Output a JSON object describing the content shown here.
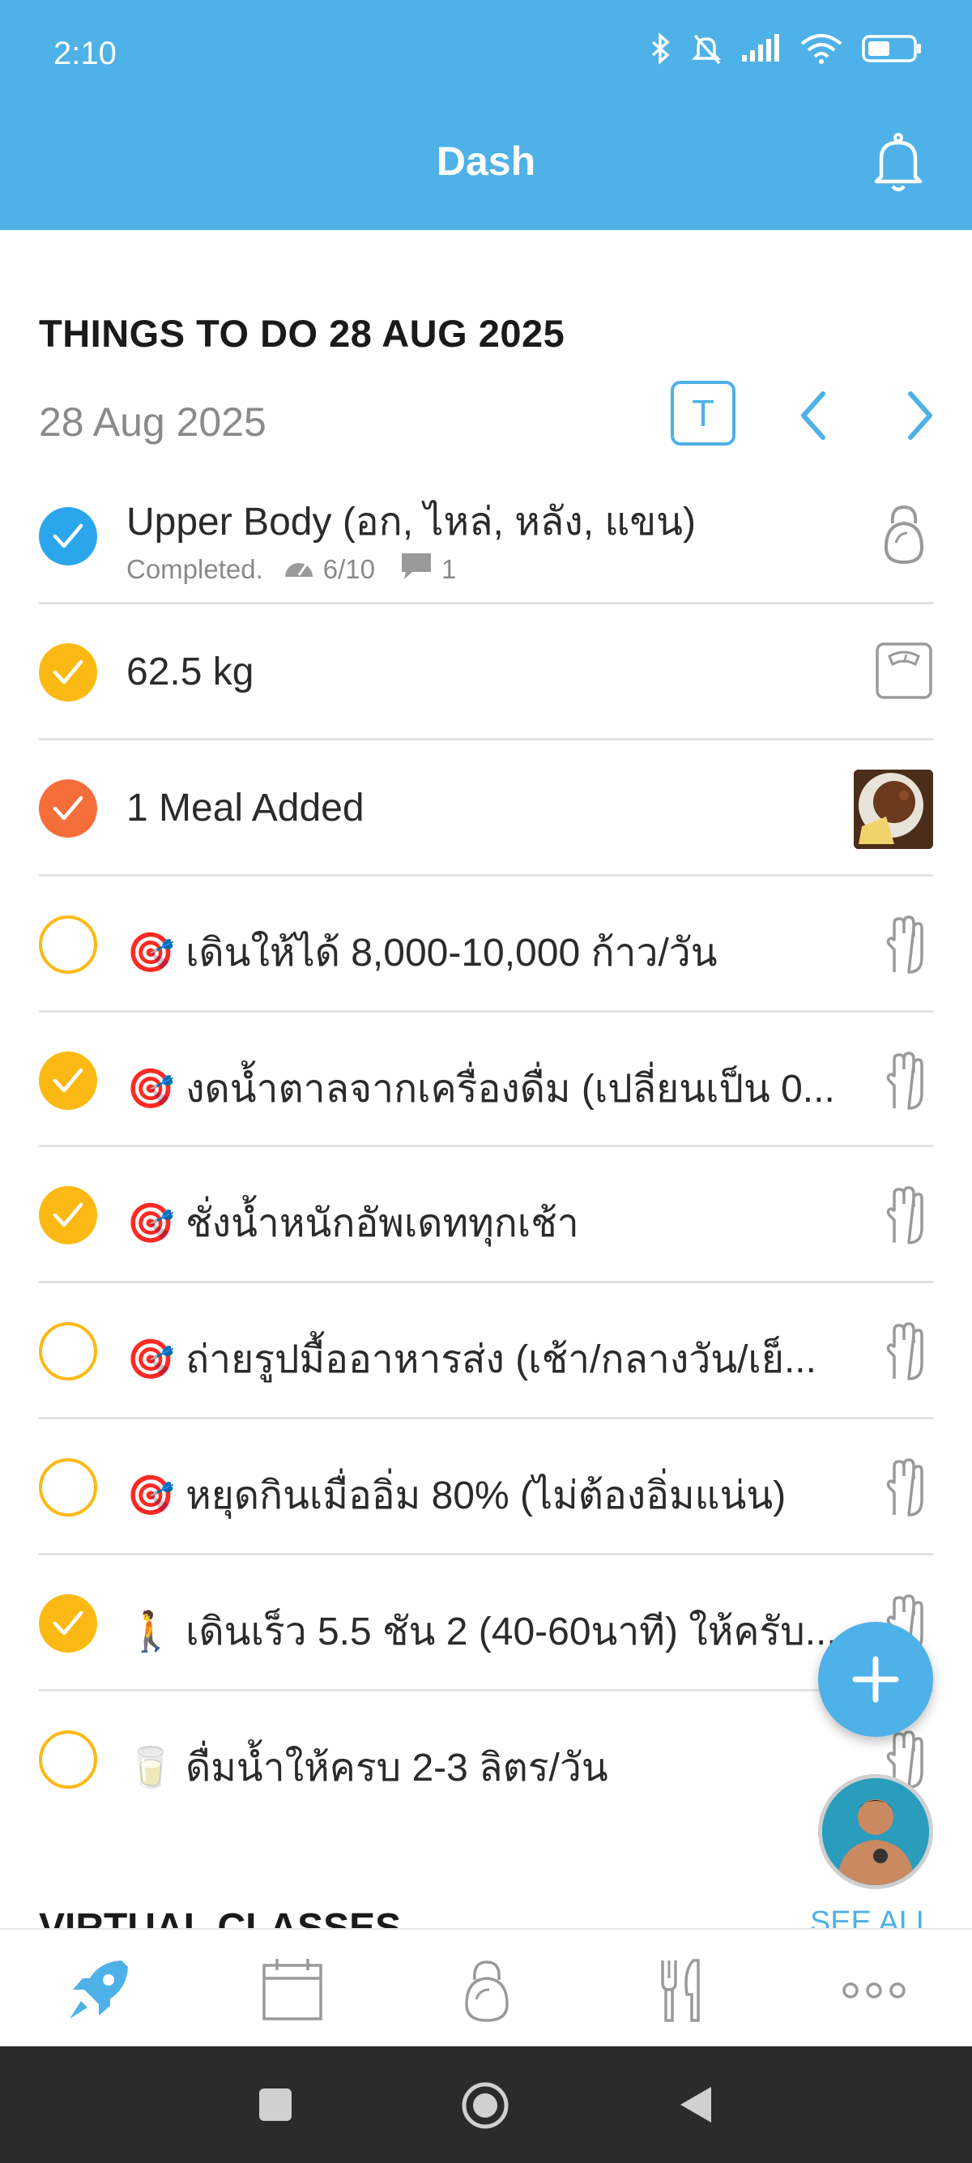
{
  "status": {
    "time": "2:10"
  },
  "header": {
    "title": "Dash"
  },
  "section": {
    "title": "THINGS TO DO 28 AUG 2025",
    "date": "28 Aug 2025",
    "today_button": "T"
  },
  "items": [
    {
      "label": "Upper Body (อก, ไหล่, หลัง, แขน)",
      "status": "Completed.",
      "effort": "6/10",
      "comments": "1",
      "check": "blue",
      "icon": "kettlebell-icon"
    },
    {
      "label": "62.5 kg",
      "check": "yellow",
      "icon": "scale-icon"
    },
    {
      "label": "1 Meal Added",
      "check": "orange",
      "icon": "meal-photo"
    },
    {
      "label": "🎯 เดินให้ได้ 8,000-10,000 ก้าว/วัน",
      "check": "empty",
      "icon": "hand-icon"
    },
    {
      "label": "🎯 งดน้ำตาลจากเครื่องดื่ม (เปลี่ยนเป็น 0...",
      "check": "yellow",
      "icon": "hand-icon"
    },
    {
      "label": "🎯 ชั่งน้ำหนักอัพเดททุกเช้า",
      "check": "yellow",
      "icon": "hand-icon"
    },
    {
      "label": "🎯 ถ่ายรูปมื้ออาหารส่ง (เช้า/กลางวัน/เย็...",
      "check": "empty",
      "icon": "hand-icon"
    },
    {
      "label": "🎯 หยุดกินเมื่ออิ่ม 80% (ไม่ต้องอิ่มแน่น)",
      "check": "empty",
      "icon": "hand-icon"
    },
    {
      "label": "🚶 เดินเร็ว 5.5 ชัน 2 (40-60นาที) ให้ครับ...",
      "check": "yellow",
      "icon": "hand-icon"
    },
    {
      "label": "🥛 ดื่มน้ำให้ครบ 2-3 ลิตร/วัน",
      "check": "empty",
      "icon": "hand-icon"
    }
  ],
  "next_section": {
    "title": "VIRTUAL CLASSES",
    "link": "SEE ALL"
  },
  "tabs": [
    "rocket-icon",
    "calendar-icon",
    "kettlebell-icon",
    "fork-knife-icon",
    "more-icon"
  ],
  "colors": {
    "header": "#4EB1E7",
    "blue_check": "#2BA6EC",
    "yellow_check": "#FDB913",
    "orange_check": "#F56E3A"
  }
}
